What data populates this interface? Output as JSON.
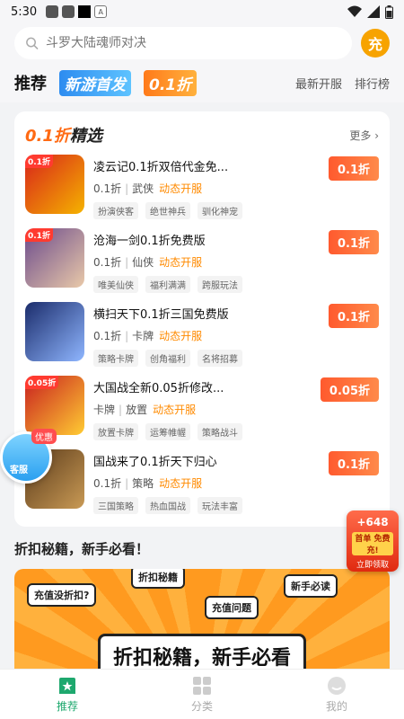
{
  "status_bar": {
    "time": "5:30",
    "a_icon": "A"
  },
  "search": {
    "placeholder": "斗罗大陆魂师对决",
    "charge_label": "充"
  },
  "nav_tabs": {
    "recommend": "推荐",
    "new_game": "新游首发",
    "discount": "0.1折",
    "newest": "最新开服",
    "ranking": "排行榜"
  },
  "featured": {
    "title_highlight": "0.1折",
    "title_rest": "精选",
    "more": "更多 ›",
    "games": [
      {
        "name": "凌云记0.1折双倍代金免...",
        "discount": "0.1折",
        "genre": "武侠",
        "status": "动态开服",
        "tags": [
          "扮演侠客",
          "绝世神兵",
          "驯化神宠"
        ],
        "corner": "0.1折"
      },
      {
        "name": "沧海一剑0.1折免费版",
        "discount": "0.1折",
        "genre": "仙侠",
        "status": "动态开服",
        "tags": [
          "唯美仙侠",
          "福利满满",
          "跨服玩法"
        ],
        "corner": "0.1折"
      },
      {
        "name": "横扫天下0.1折三国免费版",
        "discount": "0.1折",
        "genre": "卡牌",
        "status": "动态开服",
        "tags": [
          "策略卡牌",
          "创角福利",
          "名将招募"
        ],
        "corner": ""
      },
      {
        "name": "大国战全新0.05折修改...",
        "discount": "0.05折",
        "genre": "卡牌",
        "genre2": "放置",
        "status": "动态开服",
        "tags": [
          "放置卡牌",
          "运筹帷幄",
          "策略战斗"
        ],
        "corner": "0.05折"
      },
      {
        "name": "国战来了0.1折天下归心",
        "discount": "0.1折",
        "genre": "策略",
        "status": "动态开服",
        "tags": [
          "三国策略",
          "热血国战",
          "玩法丰富"
        ],
        "corner": ""
      }
    ]
  },
  "section2_title": "折扣秘籍，新手必看！",
  "banner": {
    "bubble1": "折扣秘籍",
    "bubble2": "充值没折扣?",
    "bubble3": "充值问题",
    "bubble4": "新手必读",
    "main_text": "折扣秘籍，新手必看"
  },
  "float_service": {
    "badge": "优惠",
    "label": "客服"
  },
  "float_gift": {
    "amount": "+648",
    "sub": "首单 免费充!",
    "claim": "立即领取"
  },
  "bottom_nav": {
    "home": "推荐",
    "category": "分类",
    "mine": "我的"
  },
  "colors": {
    "accent_orange": "#ff6a13",
    "discount_red": "#ff5a2e",
    "active_green": "#1ea86e"
  }
}
